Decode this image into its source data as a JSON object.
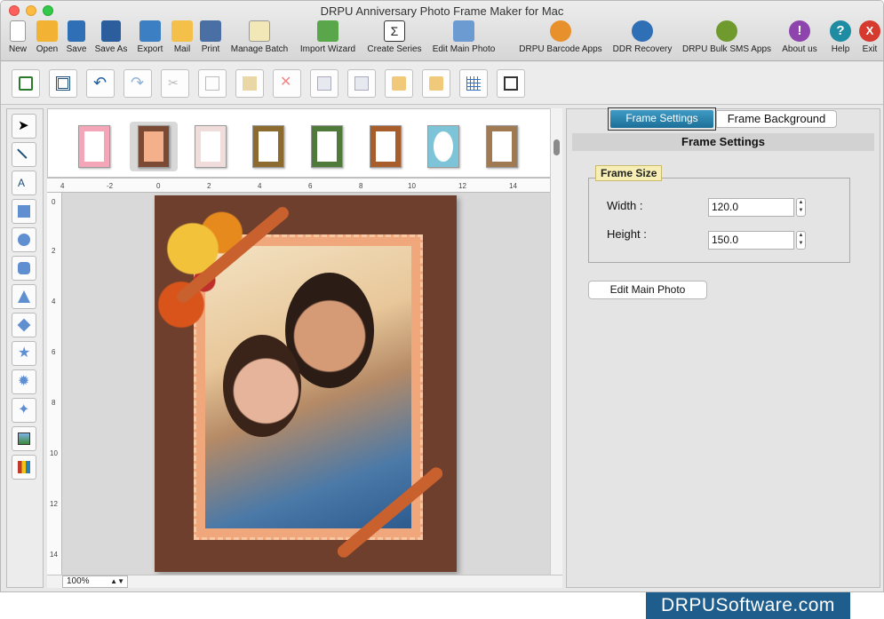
{
  "window": {
    "title": "DRPU Anniversary Photo Frame Maker for Mac"
  },
  "toolbar": {
    "items": [
      {
        "label": "New",
        "icon": "new-document-icon"
      },
      {
        "label": "Open",
        "icon": "open-folder-icon"
      },
      {
        "label": "Save",
        "icon": "save-icon"
      },
      {
        "label": "Save As",
        "icon": "save-as-icon"
      },
      {
        "label": "Export",
        "icon": "export-icon"
      },
      {
        "label": "Mail",
        "icon": "mail-icon"
      },
      {
        "label": "Print",
        "icon": "printer-icon"
      },
      {
        "label": "Manage Batch",
        "icon": "manage-batch-icon"
      },
      {
        "label": "Import Wizard",
        "icon": "import-wizard-icon"
      },
      {
        "label": "Create Series",
        "icon": "sigma-series-icon"
      },
      {
        "label": "Edit Main Photo",
        "icon": "edit-photo-icon"
      },
      {
        "label": "DRPU Barcode Apps",
        "icon": "barcode-icon"
      },
      {
        "label": "DDR Recovery",
        "icon": "recovery-icon"
      },
      {
        "label": "DRPU Bulk SMS Apps",
        "icon": "sms-envelope-icon"
      },
      {
        "label": "About us",
        "icon": "info-icon"
      },
      {
        "label": "Help",
        "icon": "help-icon"
      },
      {
        "label": "Exit",
        "icon": "exit-icon"
      }
    ]
  },
  "toolbar2": {
    "icons": [
      "add-item-icon",
      "frame-icon",
      "undo-icon",
      "redo-icon",
      "cut-icon",
      "copy-icon",
      "paste-icon",
      "delete-icon",
      "bring-forward-icon",
      "send-backward-icon",
      "lock-icon",
      "unlock-icon",
      "grid-icon",
      "ruler-view-icon"
    ]
  },
  "lefttools": {
    "icons": [
      "pointer-icon",
      "line-icon",
      "text-icon",
      "rectangle-icon",
      "ellipse-icon",
      "rounded-rectangle-icon",
      "triangle-icon",
      "diamond-icon",
      "star-icon",
      "burst-icon",
      "four-point-star-icon",
      "image-icon",
      "library-icon"
    ]
  },
  "ruler": {
    "h_ticks": [
      "4",
      "-2",
      "0",
      "2",
      "4",
      "6",
      "8",
      "10",
      "12",
      "14"
    ],
    "v_ticks": [
      "0",
      "2",
      "4",
      "6",
      "8",
      "10",
      "12",
      "14"
    ]
  },
  "zoom": {
    "value": "100%"
  },
  "rightpanel": {
    "tab_frame_settings": "Frame Settings",
    "tab_frame_background": "Frame Background",
    "heading": "Frame Settings",
    "frame_size_legend": "Frame Size",
    "width_label": "Width :",
    "width_value": "120.0",
    "height_label": "Height :",
    "height_value": "150.0",
    "edit_main_photo": "Edit Main Photo"
  },
  "brand": {
    "text": "DRPUSoftware.com"
  },
  "colors": {
    "tab_active": "#1c6f98",
    "legend_bg": "#f6eeb4",
    "brand_bg": "#1e5d8c",
    "frame_brown": "#6e3f2c",
    "stamp_orange": "#f0a77b"
  }
}
